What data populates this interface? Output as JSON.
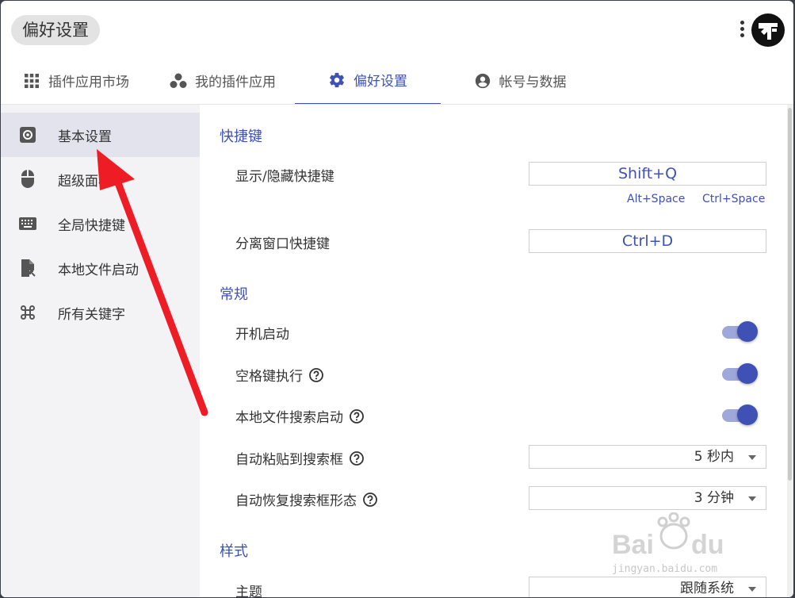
{
  "header": {
    "title": "偏好设置"
  },
  "tabs": [
    {
      "label": "插件应用市场",
      "icon": "grid-icon"
    },
    {
      "label": "我的插件应用",
      "icon": "bubbles-icon"
    },
    {
      "label": "偏好设置",
      "icon": "gear-icon",
      "active": true
    },
    {
      "label": "帐号与数据",
      "icon": "account-circle-icon"
    }
  ],
  "sidebar": {
    "items": [
      {
        "label": "基本设置",
        "icon": "settings-box-icon",
        "active": true
      },
      {
        "label": "超级面板",
        "icon": "mouse-icon"
      },
      {
        "label": "全局快捷键",
        "icon": "keyboard-icon"
      },
      {
        "label": "本地文件启动",
        "icon": "file-shortcut-icon"
      },
      {
        "label": "所有关键字",
        "icon": "command-icon"
      }
    ]
  },
  "content": {
    "shortcuts": {
      "title": "快捷键",
      "show_hide_label": "显示/隐藏快捷键",
      "show_hide_value": "Shift+Q",
      "hint_alt_space": "Alt+Space",
      "hint_ctrl_space": "Ctrl+Space",
      "detach_label": "分离窗口快捷键",
      "detach_value": "Ctrl+D"
    },
    "general": {
      "title": "常规",
      "autostart_label": "开机启动",
      "autostart_on": true,
      "space_exec_label": "空格键执行",
      "space_exec_on": true,
      "local_file_search_label": "本地文件搜索启动",
      "local_file_search_on": true,
      "auto_paste_label": "自动粘贴到搜索框",
      "auto_paste_value": "5 秒内",
      "auto_restore_label": "自动恢复搜索框形态",
      "auto_restore_value": "3 分钟"
    },
    "style": {
      "title": "样式",
      "theme_label": "主题",
      "theme_value": "跟随系统"
    }
  },
  "watermark": {
    "text": "jingyan.baidu.com"
  },
  "colors": {
    "accent": "#3f51b5",
    "toggle_track": "#9fa8da",
    "sidebar_bg": "#f3f3f5",
    "sidebar_active": "#e2e3ec",
    "annotation_arrow": "#ee1c25"
  }
}
